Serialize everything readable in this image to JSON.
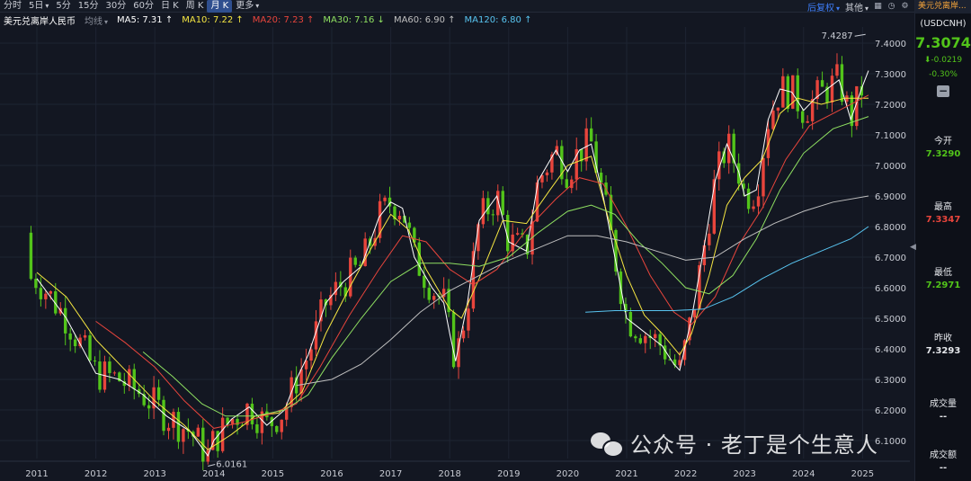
{
  "toolbar": {
    "tabs": [
      {
        "label": "分时",
        "active": false,
        "dropdown": false
      },
      {
        "label": "5日",
        "active": false,
        "dropdown": true
      },
      {
        "label": "5分",
        "active": false,
        "dropdown": false
      },
      {
        "label": "15分",
        "active": false,
        "dropdown": false
      },
      {
        "label": "30分",
        "active": false,
        "dropdown": false
      },
      {
        "label": "60分",
        "active": false,
        "dropdown": false
      },
      {
        "label": "日 K",
        "active": false,
        "dropdown": false
      },
      {
        "label": "周 K",
        "active": false,
        "dropdown": false
      },
      {
        "label": "月 K",
        "active": true,
        "dropdown": false
      },
      {
        "label": "更多",
        "active": false,
        "dropdown": true
      }
    ],
    "adjust_label": "后复权",
    "other_label": "其他",
    "icons": [
      "layout-icon",
      "clock-icon",
      "settings-icon"
    ]
  },
  "legend": {
    "title": "美元兑离岸人民币",
    "avg_label": "均线",
    "items": [
      {
        "text": "MA5: 7.31 ↑",
        "color": "#ffffff"
      },
      {
        "text": "MA10: 7.22 ↑",
        "color": "#f5e642"
      },
      {
        "text": "MA20: 7.23 ↑",
        "color": "#e8453c"
      },
      {
        "text": "MA30: 7.16 ↓",
        "color": "#8fe061"
      },
      {
        "text": "MA60: 6.90 ↑",
        "color": "#bfbfbf"
      },
      {
        "text": "MA120: 6.80 ↑",
        "color": "#58c4f0"
      }
    ]
  },
  "chart_controls": [
    "minus",
    "plus",
    "gear",
    "close"
  ],
  "colors": {
    "up": "#e8453c",
    "down": "#52c41a",
    "background": "#131722",
    "grid": "#1e2432"
  },
  "chart_data": {
    "type": "candlestick",
    "y_ticks": [
      "7.4000",
      "7.3000",
      "7.2000",
      "7.1000",
      "7.0000",
      "6.9000",
      "6.8000",
      "6.7000",
      "6.6000",
      "6.5000",
      "6.4000",
      "6.3000",
      "6.2000",
      "6.1000"
    ],
    "ylim": [
      6.0,
      7.45
    ],
    "x_ticks": [
      "2011",
      "2012",
      "2013",
      "2014",
      "2015",
      "2016",
      "2017",
      "2018",
      "2019",
      "2020",
      "2021",
      "2022",
      "2023",
      "2024",
      "2025"
    ],
    "annotations": {
      "high": "7.4287",
      "low": "6.0161"
    },
    "ma_series": [
      {
        "name": "MA5",
        "color": "#ffffff",
        "points": [
          [
            2011.0,
            6.63
          ],
          [
            2011.5,
            6.5
          ],
          [
            2012.0,
            6.32
          ],
          [
            2012.4,
            6.3
          ],
          [
            2012.8,
            6.25
          ],
          [
            2013.2,
            6.18
          ],
          [
            2013.6,
            6.13
          ],
          [
            2013.9,
            6.05
          ],
          [
            2014.0,
            6.1
          ],
          [
            2014.3,
            6.17
          ],
          [
            2014.6,
            6.21
          ],
          [
            2014.9,
            6.15
          ],
          [
            2015.2,
            6.2
          ],
          [
            2015.4,
            6.3
          ],
          [
            2015.6,
            6.38
          ],
          [
            2015.9,
            6.55
          ],
          [
            2016.2,
            6.62
          ],
          [
            2016.5,
            6.67
          ],
          [
            2016.8,
            6.83
          ],
          [
            2017.0,
            6.88
          ],
          [
            2017.2,
            6.86
          ],
          [
            2017.4,
            6.7
          ],
          [
            2017.7,
            6.6
          ],
          [
            2017.9,
            6.55
          ],
          [
            2018.0,
            6.45
          ],
          [
            2018.1,
            6.36
          ],
          [
            2018.3,
            6.55
          ],
          [
            2018.5,
            6.82
          ],
          [
            2018.8,
            6.9
          ],
          [
            2019.0,
            6.75
          ],
          [
            2019.3,
            6.72
          ],
          [
            2019.5,
            6.95
          ],
          [
            2019.8,
            7.05
          ],
          [
            2020.0,
            6.98
          ],
          [
            2020.2,
            7.05
          ],
          [
            2020.4,
            7.07
          ],
          [
            2020.6,
            6.9
          ],
          [
            2020.8,
            6.7
          ],
          [
            2021.0,
            6.5
          ],
          [
            2021.2,
            6.47
          ],
          [
            2021.4,
            6.44
          ],
          [
            2021.6,
            6.41
          ],
          [
            2021.8,
            6.35
          ],
          [
            2021.9,
            6.33
          ],
          [
            2022.1,
            6.5
          ],
          [
            2022.3,
            6.72
          ],
          [
            2022.5,
            6.95
          ],
          [
            2022.7,
            7.07
          ],
          [
            2022.9,
            6.98
          ],
          [
            2023.0,
            6.9
          ],
          [
            2023.2,
            6.92
          ],
          [
            2023.4,
            7.15
          ],
          [
            2023.6,
            7.25
          ],
          [
            2023.8,
            7.24
          ],
          [
            2024.0,
            7.18
          ],
          [
            2024.2,
            7.22
          ],
          [
            2024.4,
            7.25
          ],
          [
            2024.6,
            7.28
          ],
          [
            2024.8,
            7.15
          ],
          [
            2025.0,
            7.26
          ],
          [
            2025.1,
            7.31
          ]
        ]
      },
      {
        "name": "MA10",
        "color": "#f5e642",
        "points": [
          [
            2011.0,
            6.65
          ],
          [
            2011.5,
            6.57
          ],
          [
            2012.0,
            6.43
          ],
          [
            2012.5,
            6.33
          ],
          [
            2013.0,
            6.23
          ],
          [
            2013.5,
            6.15
          ],
          [
            2013.9,
            6.07
          ],
          [
            2014.3,
            6.12
          ],
          [
            2014.7,
            6.18
          ],
          [
            2015.1,
            6.19
          ],
          [
            2015.5,
            6.26
          ],
          [
            2015.9,
            6.45
          ],
          [
            2016.3,
            6.6
          ],
          [
            2016.7,
            6.74
          ],
          [
            2017.0,
            6.84
          ],
          [
            2017.3,
            6.79
          ],
          [
            2017.6,
            6.66
          ],
          [
            2018.0,
            6.53
          ],
          [
            2018.2,
            6.5
          ],
          [
            2018.5,
            6.63
          ],
          [
            2018.9,
            6.82
          ],
          [
            2019.3,
            6.81
          ],
          [
            2019.7,
            6.92
          ],
          [
            2020.0,
            7.0
          ],
          [
            2020.4,
            7.03
          ],
          [
            2020.7,
            6.82
          ],
          [
            2021.0,
            6.64
          ],
          [
            2021.3,
            6.51
          ],
          [
            2021.6,
            6.45
          ],
          [
            2021.9,
            6.38
          ],
          [
            2022.1,
            6.45
          ],
          [
            2022.4,
            6.64
          ],
          [
            2022.7,
            6.87
          ],
          [
            2023.0,
            6.96
          ],
          [
            2023.3,
            7.02
          ],
          [
            2023.6,
            7.17
          ],
          [
            2023.9,
            7.22
          ],
          [
            2024.3,
            7.2
          ],
          [
            2024.7,
            7.22
          ],
          [
            2025.1,
            7.22
          ]
        ]
      },
      {
        "name": "MA20",
        "color": "#e8453c",
        "points": [
          [
            2012.0,
            6.49
          ],
          [
            2012.5,
            6.42
          ],
          [
            2013.0,
            6.34
          ],
          [
            2013.5,
            6.23
          ],
          [
            2014.0,
            6.14
          ],
          [
            2014.5,
            6.16
          ],
          [
            2015.0,
            6.19
          ],
          [
            2015.4,
            6.22
          ],
          [
            2015.8,
            6.34
          ],
          [
            2016.3,
            6.51
          ],
          [
            2016.8,
            6.66
          ],
          [
            2017.2,
            6.77
          ],
          [
            2017.6,
            6.75
          ],
          [
            2018.0,
            6.66
          ],
          [
            2018.4,
            6.61
          ],
          [
            2018.8,
            6.66
          ],
          [
            2019.3,
            6.79
          ],
          [
            2019.8,
            6.89
          ],
          [
            2020.2,
            6.96
          ],
          [
            2020.6,
            6.94
          ],
          [
            2021.0,
            6.8
          ],
          [
            2021.4,
            6.64
          ],
          [
            2021.8,
            6.52
          ],
          [
            2022.1,
            6.48
          ],
          [
            2022.5,
            6.57
          ],
          [
            2022.9,
            6.74
          ],
          [
            2023.3,
            6.86
          ],
          [
            2023.7,
            7.02
          ],
          [
            2024.1,
            7.13
          ],
          [
            2024.6,
            7.18
          ],
          [
            2025.1,
            7.23
          ]
        ]
      },
      {
        "name": "MA30",
        "color": "#8fe061",
        "points": [
          [
            2012.8,
            6.39
          ],
          [
            2013.3,
            6.31
          ],
          [
            2013.8,
            6.22
          ],
          [
            2014.2,
            6.18
          ],
          [
            2014.7,
            6.18
          ],
          [
            2015.2,
            6.2
          ],
          [
            2015.6,
            6.25
          ],
          [
            2016.0,
            6.37
          ],
          [
            2016.5,
            6.5
          ],
          [
            2017.0,
            6.62
          ],
          [
            2017.5,
            6.68
          ],
          [
            2018.0,
            6.68
          ],
          [
            2018.5,
            6.67
          ],
          [
            2019.0,
            6.7
          ],
          [
            2019.5,
            6.78
          ],
          [
            2020.0,
            6.85
          ],
          [
            2020.4,
            6.87
          ],
          [
            2020.8,
            6.84
          ],
          [
            2021.2,
            6.75
          ],
          [
            2021.6,
            6.68
          ],
          [
            2022.0,
            6.6
          ],
          [
            2022.4,
            6.58
          ],
          [
            2022.8,
            6.64
          ],
          [
            2023.2,
            6.76
          ],
          [
            2023.6,
            6.92
          ],
          [
            2024.0,
            7.04
          ],
          [
            2024.5,
            7.12
          ],
          [
            2025.1,
            7.16
          ]
        ]
      },
      {
        "name": "MA60",
        "color": "#bfbfbf",
        "points": [
          [
            2015.4,
            6.28
          ],
          [
            2016.0,
            6.3
          ],
          [
            2016.5,
            6.35
          ],
          [
            2017.0,
            6.43
          ],
          [
            2017.5,
            6.52
          ],
          [
            2018.0,
            6.59
          ],
          [
            2018.5,
            6.64
          ],
          [
            2019.0,
            6.69
          ],
          [
            2019.5,
            6.73
          ],
          [
            2020.0,
            6.77
          ],
          [
            2020.5,
            6.77
          ],
          [
            2021.0,
            6.75
          ],
          [
            2021.5,
            6.72
          ],
          [
            2022.0,
            6.69
          ],
          [
            2022.5,
            6.7
          ],
          [
            2023.0,
            6.76
          ],
          [
            2023.5,
            6.81
          ],
          [
            2024.0,
            6.85
          ],
          [
            2024.5,
            6.88
          ],
          [
            2025.1,
            6.9
          ]
        ]
      },
      {
        "name": "MA120",
        "color": "#58c4f0",
        "points": [
          [
            2020.3,
            6.52
          ],
          [
            2020.8,
            6.525
          ],
          [
            2021.3,
            6.525
          ],
          [
            2021.8,
            6.525
          ],
          [
            2022.3,
            6.53
          ],
          [
            2022.8,
            6.57
          ],
          [
            2023.3,
            6.63
          ],
          [
            2023.8,
            6.68
          ],
          [
            2024.3,
            6.72
          ],
          [
            2024.8,
            6.76
          ],
          [
            2025.1,
            6.8
          ]
        ]
      }
    ]
  },
  "sidebar": {
    "name": "美元兑离岸...",
    "code": "(USDCNH)",
    "price": "7.3074",
    "change": "-0.0219",
    "pct": "-0.30%",
    "open_label": "今开",
    "open_value": "7.3290",
    "high_label": "最高",
    "high_value": "7.3347",
    "low_label": "最低",
    "low_value": "7.2971",
    "prev_label": "昨收",
    "prev_value": "7.3293",
    "vol_label": "成交量",
    "vol_value": "--",
    "amt_label": "成交额",
    "amt_value": "--"
  },
  "watermark": {
    "text": "公众号 · 老丁是个生意人"
  }
}
